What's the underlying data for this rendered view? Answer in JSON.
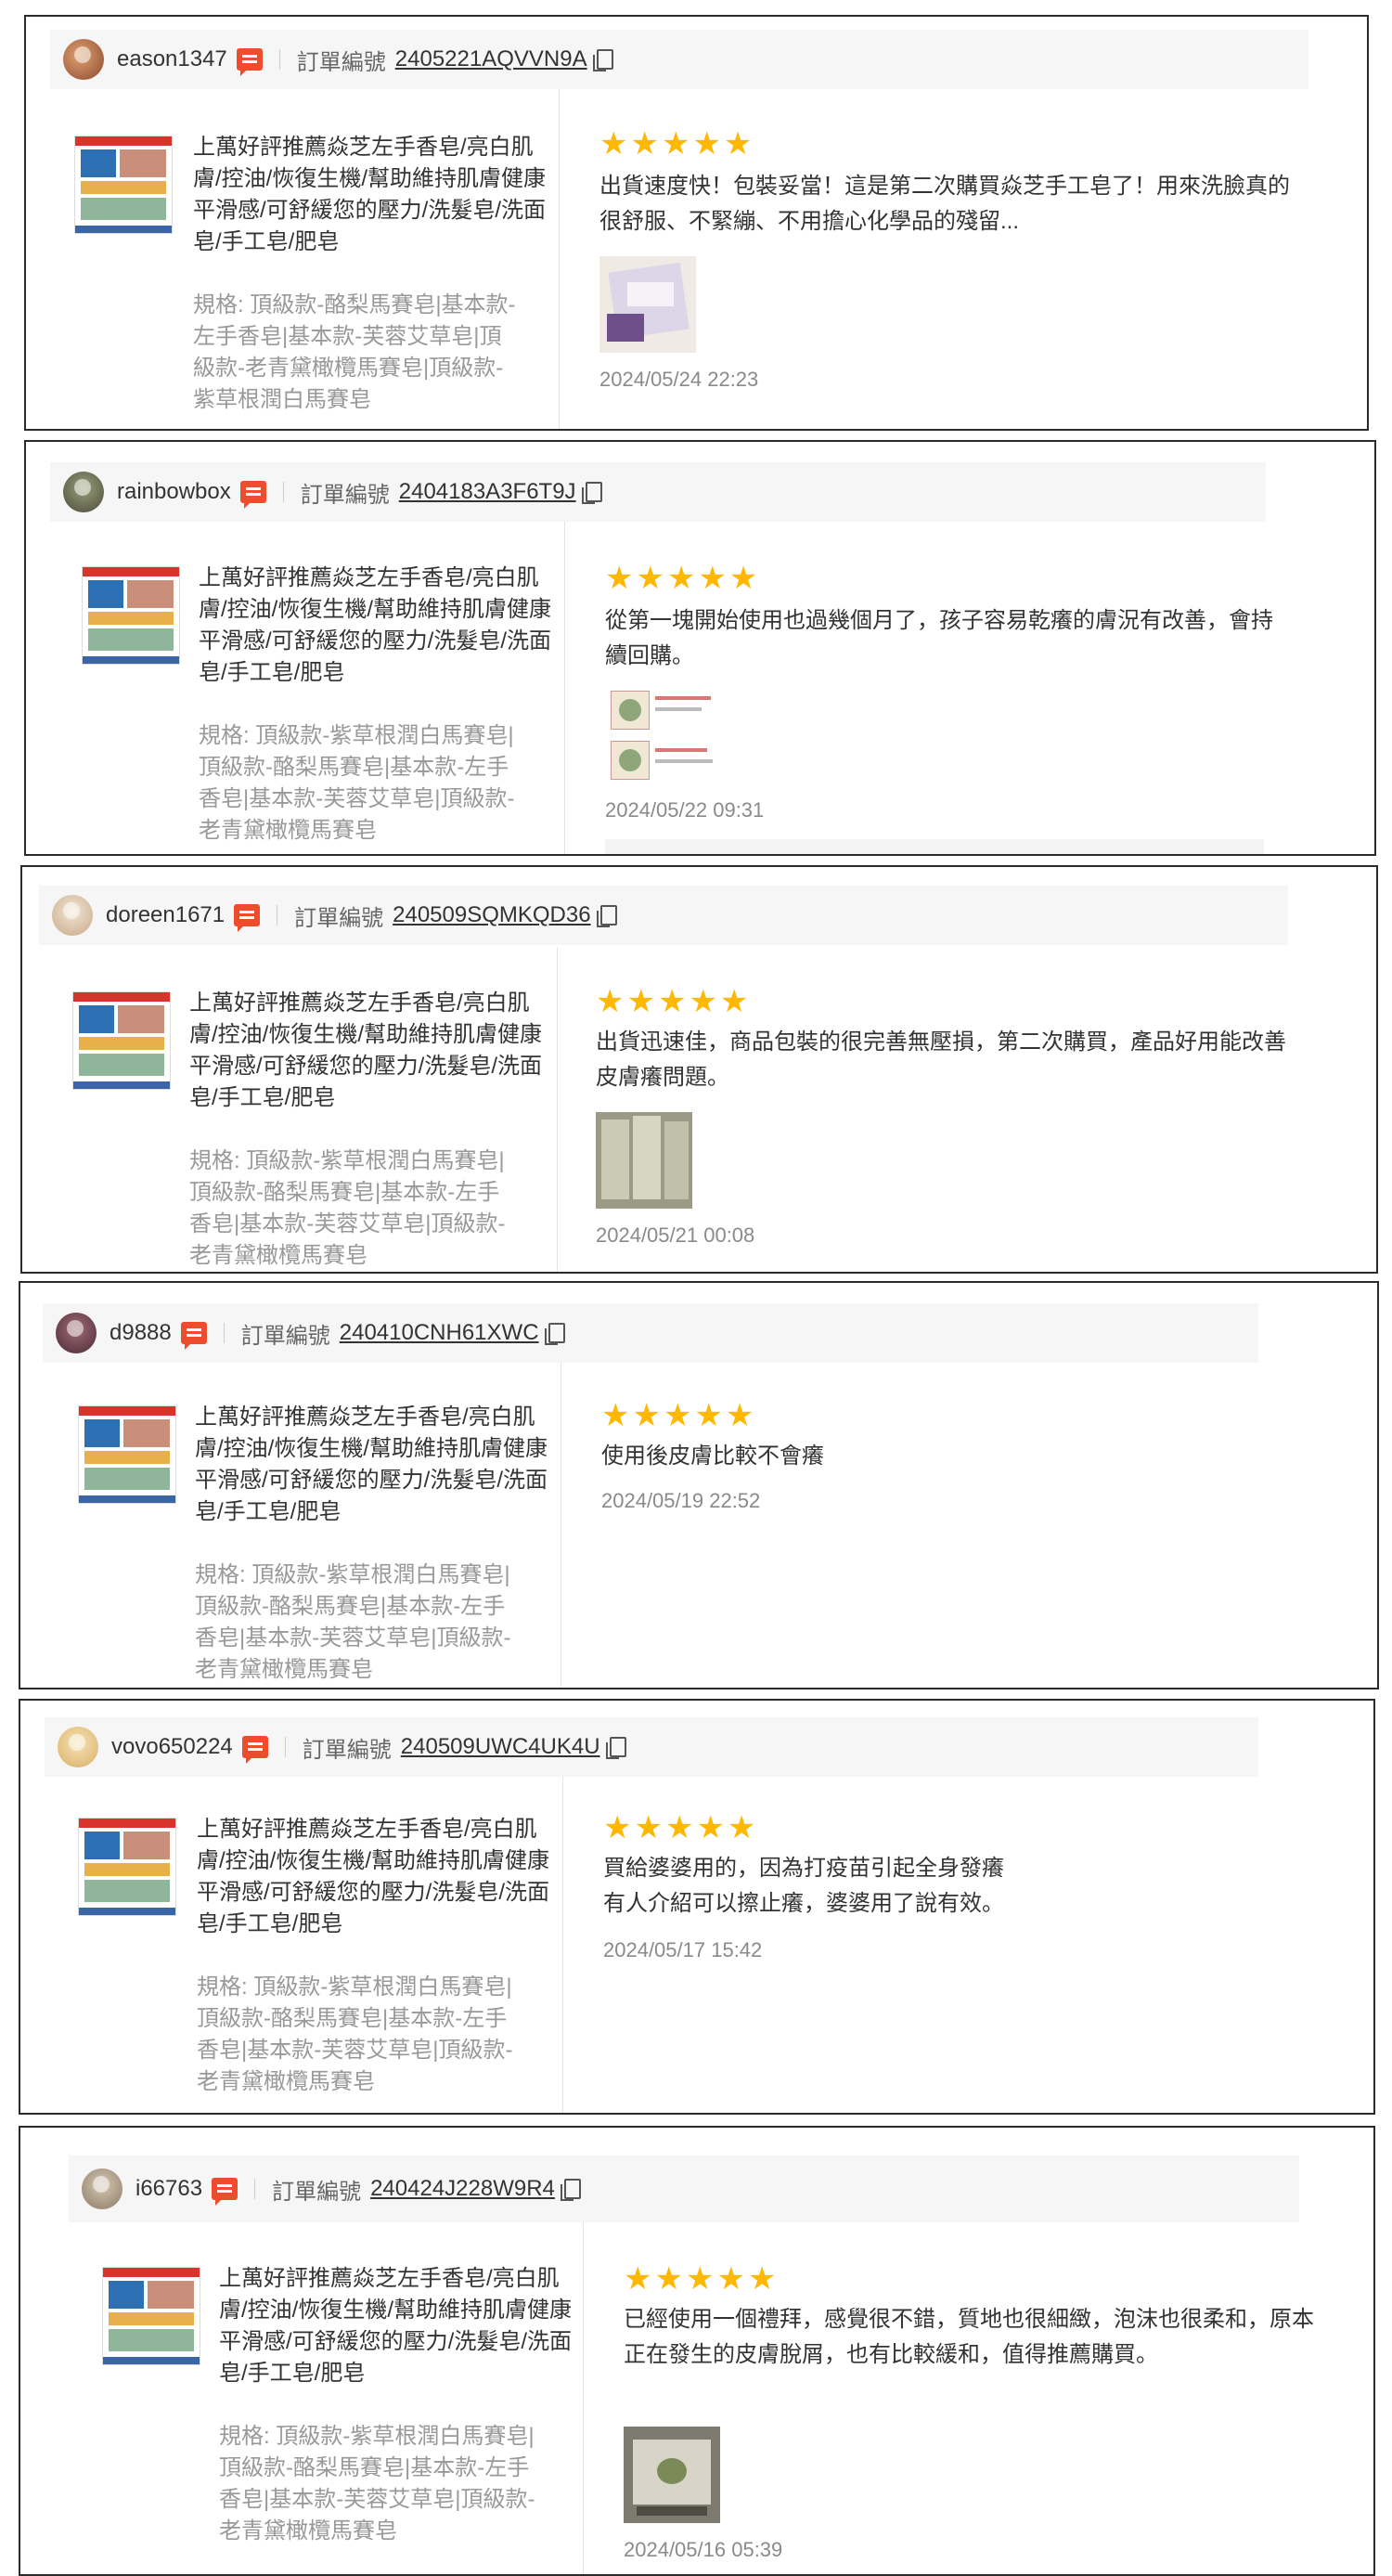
{
  "common": {
    "order_label": "訂單編號",
    "product_title": "上萬好評推薦焱芝左手香皂/亮白肌膚/控油/恢復生機/幫助維持肌膚健康平滑感/可舒緩您的壓力/洗髮皂/洗面皂/手工皂/肥皂",
    "stars": "★★★★★"
  },
  "colors": {
    "accent": "#ee4d2d",
    "star": "#ffb800"
  },
  "reviews": [
    {
      "username": "eason1347",
      "order_no": "2405221AQVVN9A",
      "variation": "規格: 頂級款-酪梨馬賽皂|基本款-左手香皂|基本款-芙蓉艾草皂|頂級款-老青黛橄欖馬賽皂|頂級款-紫草根潤白馬賽皂",
      "comment": "出貨速度快！包裝妥當！這是第二次購買焱芝手工皂了！用來洗臉真的很舒服、不緊繃、不用擔心化學品的殘留...",
      "date": "2024/05/24 22:23"
    },
    {
      "username": "rainbowbox",
      "order_no": "2404183A3F6T9J",
      "variation": "規格: 頂級款-紫草根潤白馬賽皂|頂級款-酪梨馬賽皂|基本款-左手香皂|基本款-芙蓉艾草皂|頂級款-老青黛橄欖馬賽皂",
      "comment": "從第一塊開始使用也過幾個月了，孩子容易乾癢的膚況有改善，會持續回購。",
      "date": "2024/05/22 09:31"
    },
    {
      "username": "doreen1671",
      "order_no": "240509SQMKQD36",
      "variation": "規格: 頂級款-紫草根潤白馬賽皂|頂級款-酪梨馬賽皂|基本款-左手香皂|基本款-芙蓉艾草皂|頂級款-老青黛橄欖馬賽皂",
      "comment": "出貨迅速佳，商品包裝的很完善無壓損，第二次購買，產品好用能改善皮膚癢問題。",
      "date": "2024/05/21 00:08"
    },
    {
      "username": "d9888",
      "order_no": "240410CNH61XWC",
      "variation": "規格: 頂級款-紫草根潤白馬賽皂|頂級款-酪梨馬賽皂|基本款-左手香皂|基本款-芙蓉艾草皂|頂級款-老青黛橄欖馬賽皂",
      "comment": "使用後皮膚比較不會癢",
      "date": "2024/05/19 22:52"
    },
    {
      "username": "vovo650224",
      "order_no": "240509UWC4UK4U",
      "variation": "規格: 頂級款-紫草根潤白馬賽皂|頂級款-酪梨馬賽皂|基本款-左手香皂|基本款-芙蓉艾草皂|頂級款-老青黛橄欖馬賽皂",
      "comment": "買給婆婆用的，因為打疫苗引起全身發癢\n有人介紹可以擦止癢，婆婆用了說有效。",
      "date": "2024/05/17 15:42"
    },
    {
      "username": "i66763",
      "order_no": "240424J228W9R4",
      "variation": "規格: 頂級款-紫草根潤白馬賽皂|頂級款-酪梨馬賽皂|基本款-左手香皂|基本款-芙蓉艾草皂|頂級款-老青黛橄欖馬賽皂",
      "comment": "已經使用一個禮拜，感覺很不錯，質地也很細緻，泡沫也很柔和，原本正在發生的皮膚脫屑，也有比較緩和，值得推薦購買。",
      "date": "2024/05/16 05:39"
    }
  ]
}
